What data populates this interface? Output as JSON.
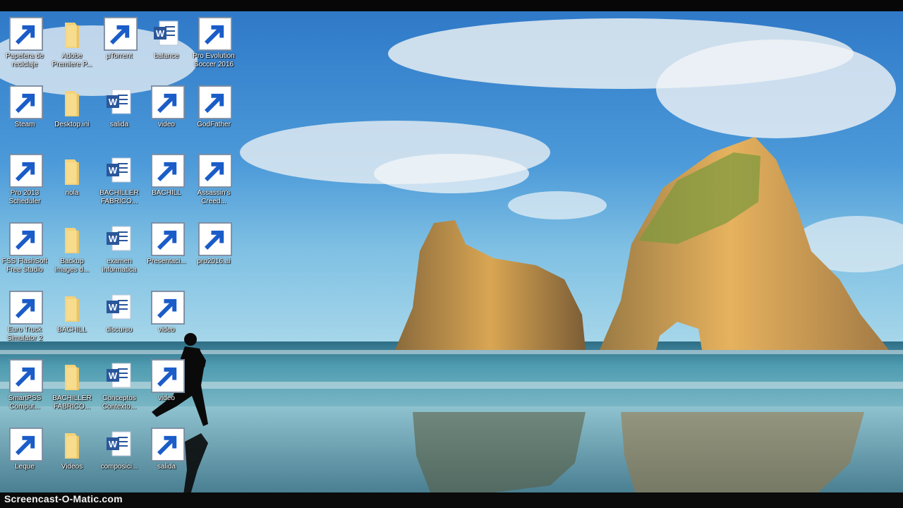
{
  "watermark": "Screencast-O-Matic.com",
  "desktop_icons": [
    {
      "label": "Papelera de reciclaje",
      "icon": "recycle-bin-icon"
    },
    {
      "label": "Adobe Premiere P...",
      "icon": "folder-icon"
    },
    {
      "label": "µTorrent",
      "icon": "utorrent-icon"
    },
    {
      "label": "balance",
      "icon": "word-doc-icon"
    },
    {
      "label": "Pro Evolution Soccer 2016",
      "icon": "pes-game-icon"
    },
    {
      "label": "Steam",
      "icon": "steam-icon"
    },
    {
      "label": "Desktop.ini",
      "icon": "folder-icon"
    },
    {
      "label": "salida",
      "icon": "word-doc-icon"
    },
    {
      "label": "video",
      "icon": "premiere-pro-icon"
    },
    {
      "label": "GodFather",
      "icon": "godfather-game-icon"
    },
    {
      "label": "Pro 2013 Scheduler",
      "icon": "round-game-icon"
    },
    {
      "label": "nola",
      "icon": "folder-icon"
    },
    {
      "label": "BACHILLER FABRICO...",
      "icon": "word-doc-icon"
    },
    {
      "label": "BACHILL",
      "icon": "winrar-icon"
    },
    {
      "label": "Assassin's Creed...",
      "icon": "assassin-game-icon"
    },
    {
      "label": "FSS FlashSoft Free Studio",
      "icon": "freestudio-icon"
    },
    {
      "label": "Backup images d...",
      "icon": "folder-icon"
    },
    {
      "label": "examen informatica",
      "icon": "word-doc-icon"
    },
    {
      "label": "Presentaci...",
      "icon": "powerpoint-icon"
    },
    {
      "label": "Euro Truck Simulator 2",
      "icon": "truck-game-icon"
    },
    {
      "label": "BACHILL",
      "icon": "folder-icon"
    },
    {
      "label": "discurso",
      "icon": "word-doc-icon"
    },
    {
      "label": "video",
      "icon": "media-file-icon"
    },
    {
      "label": "pro2016.ai",
      "icon": "media-file-icon"
    },
    {
      "label": "SmartPSS Comput...",
      "icon": "smartpss-icon"
    },
    {
      "label": "BACHILLER FABRICO...",
      "icon": "folder-icon"
    },
    {
      "label": "Conceptos Contexto...",
      "icon": "word-doc-icon"
    },
    {
      "label": "video",
      "icon": "media-file-icon"
    },
    {
      "label": "Leque",
      "icon": "wunderlist-icon"
    },
    {
      "label": "Videos",
      "icon": "folder-icon"
    },
    {
      "label": "composici...",
      "icon": "word-doc-icon"
    },
    {
      "label": "salida",
      "icon": "video-file-icon"
    }
  ]
}
